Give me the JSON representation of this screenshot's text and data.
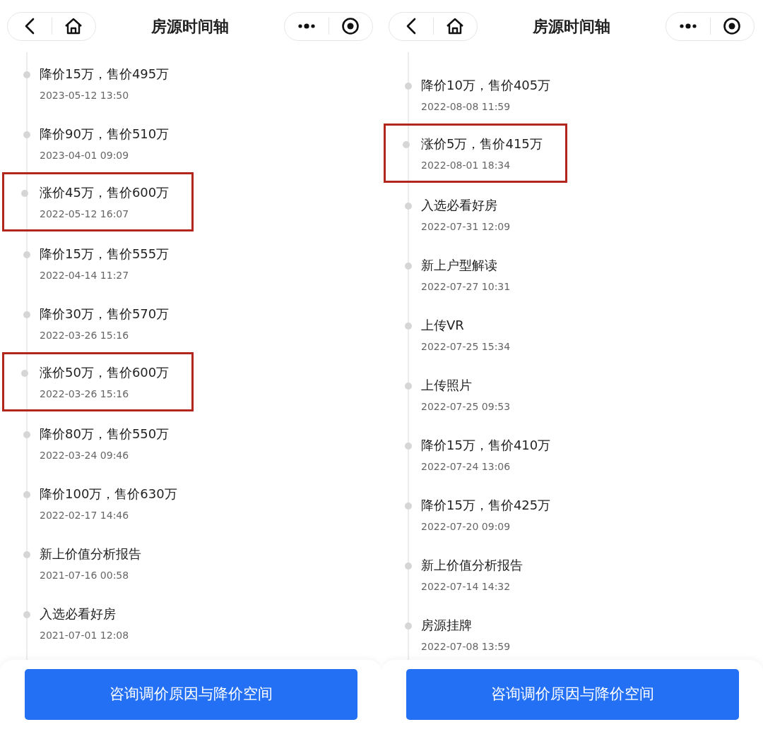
{
  "panels": [
    {
      "title": "房源时间轴",
      "events": [
        {
          "title": "降价15万，售价495万",
          "time": "2023-05-12 13:50",
          "highlighted": false
        },
        {
          "title": "降价90万，售价510万",
          "time": "2023-04-01 09:09",
          "highlighted": false
        },
        {
          "title": "涨价45万，售价600万",
          "time": "2022-05-12 16:07",
          "highlighted": true
        },
        {
          "title": "降价15万，售价555万",
          "time": "2022-04-14 11:27",
          "highlighted": false
        },
        {
          "title": "降价30万，售价570万",
          "time": "2022-03-26 15:16",
          "highlighted": false
        },
        {
          "title": "涨价50万，售价600万",
          "time": "2022-03-26 15:16",
          "highlighted": true
        },
        {
          "title": "降价80万，售价550万",
          "time": "2022-03-24 09:46",
          "highlighted": false
        },
        {
          "title": "降价100万，售价630万",
          "time": "2022-02-17 14:46",
          "highlighted": false
        },
        {
          "title": "新上价值分析报告",
          "time": "2021-07-16 00:58",
          "highlighted": false
        },
        {
          "title": "入选必看好房",
          "time": "2021-07-01 12:08",
          "highlighted": false
        }
      ],
      "button": "咨询调价原因与降价空间"
    },
    {
      "title": "房源时间轴",
      "events": [
        {
          "title": "降价10万，售价405万",
          "time": "2022-08-08 11:59",
          "highlighted": false
        },
        {
          "title": "涨价5万，售价415万",
          "time": "2022-08-01 18:34",
          "highlighted": true
        },
        {
          "title": "入选必看好房",
          "time": "2022-07-31 12:09",
          "highlighted": false
        },
        {
          "title": "新上户型解读",
          "time": "2022-07-27 10:31",
          "highlighted": false
        },
        {
          "title": "上传VR",
          "time": "2022-07-25 15:34",
          "highlighted": false
        },
        {
          "title": "上传照片",
          "time": "2022-07-25 09:53",
          "highlighted": false
        },
        {
          "title": "降价15万，售价410万",
          "time": "2022-07-24 13:06",
          "highlighted": false
        },
        {
          "title": "降价15万，售价425万",
          "time": "2022-07-20 09:09",
          "highlighted": false
        },
        {
          "title": "新上价值分析报告",
          "time": "2022-07-14 14:32",
          "highlighted": false
        },
        {
          "title": "房源挂牌",
          "time": "2022-07-08 13:59",
          "highlighted": false
        }
      ],
      "button": "咨询调价原因与降价空间"
    }
  ]
}
